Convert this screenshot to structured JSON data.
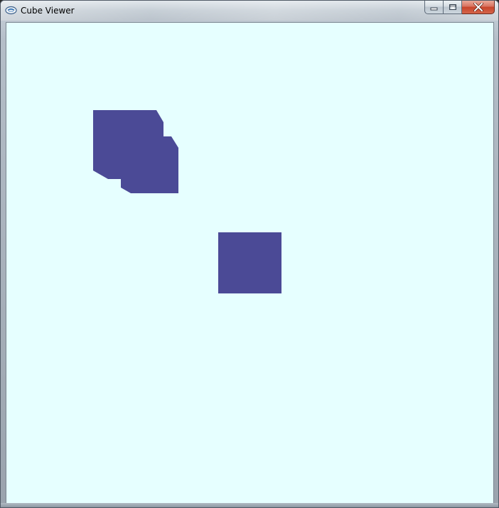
{
  "window": {
    "title": "Cube Viewer",
    "icon": "app-icon",
    "controls": {
      "minimize_icon": "minimize-icon",
      "maximize_icon": "maximize-icon",
      "close_icon": "close-icon"
    }
  },
  "viewport": {
    "background_color": "#e6ffff",
    "cube_color": "#4b4a96"
  }
}
